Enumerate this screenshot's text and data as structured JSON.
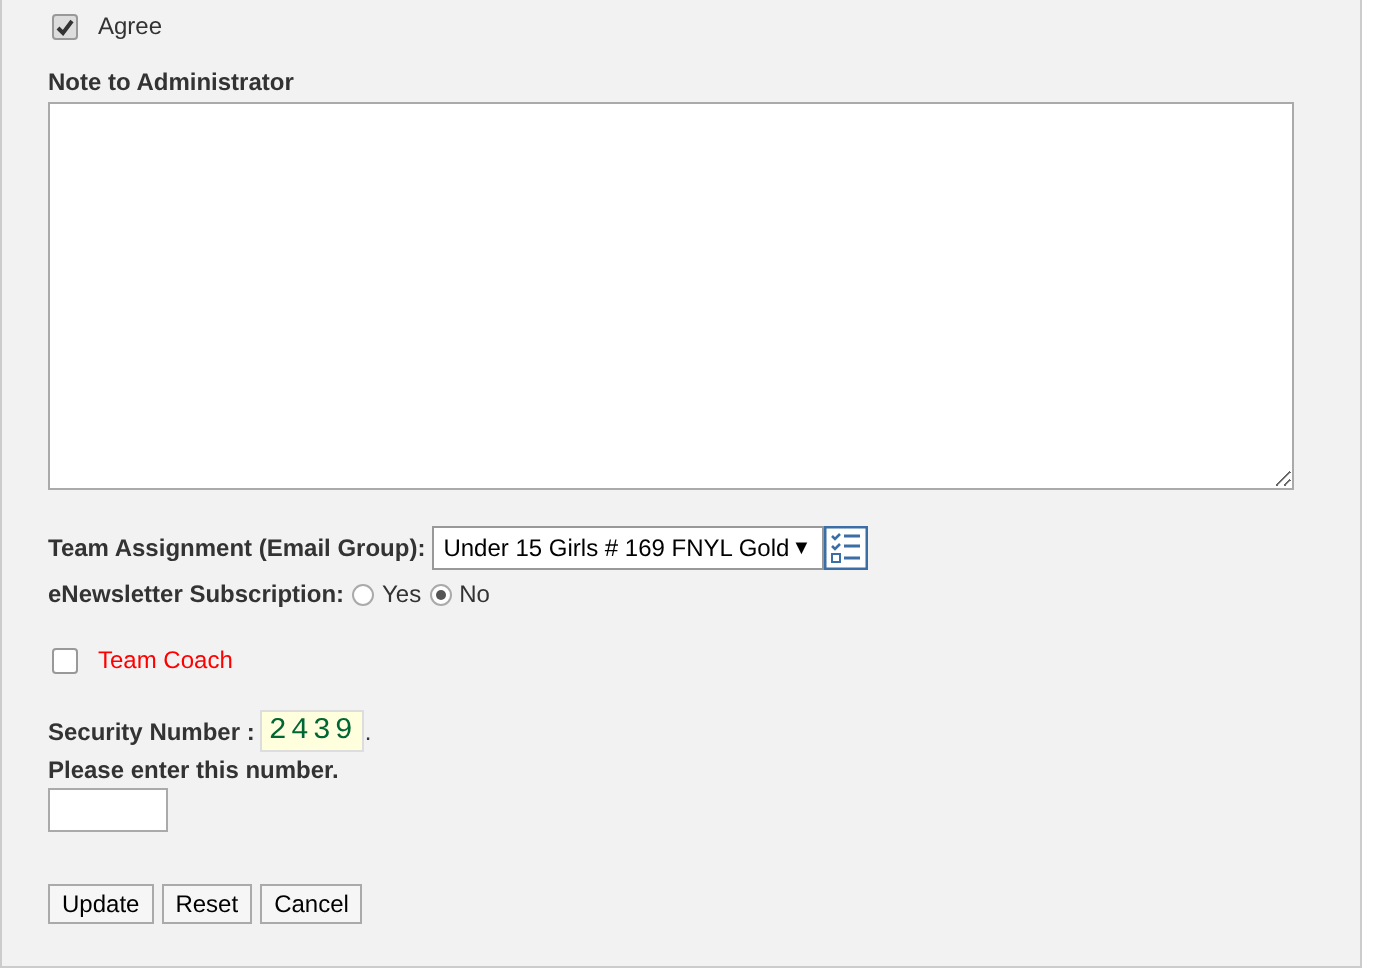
{
  "agree": {
    "label": "Agree",
    "checked": true
  },
  "note": {
    "label": "Note to Administrator"
  },
  "team_assignment": {
    "label": "Team Assignment (Email Group):",
    "value": "Under 15 Girls # 169 FNYL Gold",
    "caret": "▼"
  },
  "newsletter": {
    "label": "eNewsletter Subscription:",
    "options": [
      {
        "label": "Yes",
        "selected": false
      },
      {
        "label": "No",
        "selected": true
      }
    ]
  },
  "team_coach": {
    "label": "Team Coach",
    "checked": false
  },
  "security": {
    "label": "Security Number :",
    "number": "2439",
    "suffix": ".",
    "hint": "Please enter this number."
  },
  "buttons": [
    "Update",
    "Reset",
    "Cancel"
  ]
}
